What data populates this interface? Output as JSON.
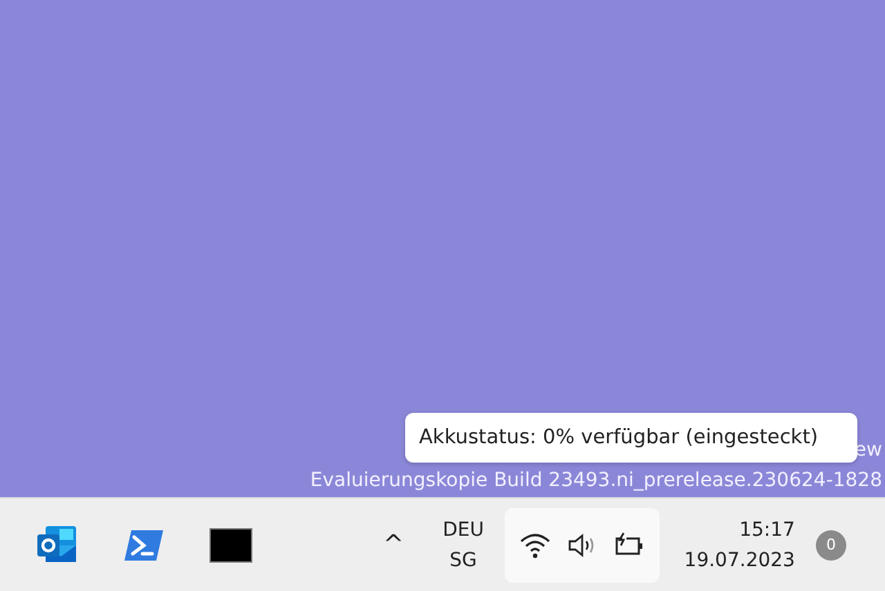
{
  "desktop": {
    "watermark_line_1": "ew",
    "watermark_line_2": "Evaluierungskopie Build 23493.ni_prerelease.230624-1828"
  },
  "tooltip": {
    "text": "Akkustatus: 0% verfügbar (eingesteckt)"
  },
  "taskbar": {
    "apps": [
      {
        "kind": "outlook"
      },
      {
        "kind": "powershell"
      },
      {
        "kind": "terminal"
      }
    ],
    "overflow": "^",
    "language": {
      "line_1": "DEU",
      "line_2": "SG"
    },
    "clock": {
      "time": "15:17",
      "date": "19.07.2023"
    },
    "notifications": "0"
  }
}
